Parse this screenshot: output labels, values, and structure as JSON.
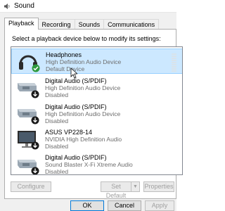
{
  "window": {
    "title": "Sound"
  },
  "tabs": [
    {
      "label": "Playback",
      "active": true
    },
    {
      "label": "Recording",
      "active": false
    },
    {
      "label": "Sounds",
      "active": false
    },
    {
      "label": "Communications",
      "active": false
    }
  ],
  "instruction": "Select a playback device below to modify its settings:",
  "devices": [
    {
      "name": "Headphones",
      "description": "High Definition Audio Device",
      "state": "Default Device",
      "icon": "headphones-icon",
      "selected": true
    },
    {
      "name": "Digital Audio (S/PDIF)",
      "description": "High Definition Audio Device",
      "state": "Disabled",
      "icon": "digital-audio-icon",
      "selected": false
    },
    {
      "name": "Digital Audio (S/PDIF)",
      "description": "High Definition Audio Device",
      "state": "Disabled",
      "icon": "digital-audio-icon",
      "selected": false
    },
    {
      "name": "ASUS VP228-14",
      "description": "NVIDIA High Definition Audio",
      "state": "Disabled",
      "icon": "monitor-icon",
      "selected": false
    },
    {
      "name": "Digital Audio (S/PDIF)",
      "description": "Sound Blaster X-Fi Xtreme Audio",
      "state": "Disabled",
      "icon": "digital-audio-icon",
      "selected": false
    }
  ],
  "buttons": {
    "configure": "Configure",
    "set_default": "Set Default",
    "properties": "Properties",
    "ok": "OK",
    "cancel": "Cancel",
    "apply": "Apply"
  },
  "colors": {
    "selection": "#cce8ff",
    "default_check": "#2e9a3e",
    "disabled_arrow": "#1a1a1a"
  }
}
